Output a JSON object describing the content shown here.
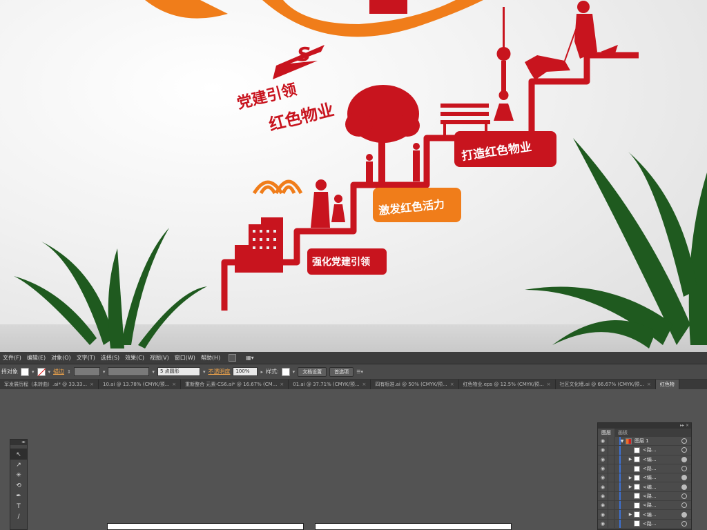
{
  "preview": {
    "logo_mark": "S",
    "slogan_line1": "党建引领",
    "slogan_line2": "红色物业",
    "step_labels": [
      "强化党建引领",
      "激发红色活力",
      "打造红色物业"
    ],
    "colors": {
      "red": "#c8141e",
      "orange": "#f07d1a",
      "wall": "#eeeeee"
    }
  },
  "menubar": {
    "items": [
      "文件(F)",
      "编辑(E)",
      "对象(O)",
      "文字(T)",
      "选择(S)",
      "效果(C)",
      "视图(V)",
      "窗口(W)",
      "帮助(H)"
    ]
  },
  "controlbar": {
    "selection_label": "择对象",
    "stroke_label": "描边",
    "brush_value": "5 点圆形",
    "opacity_label": "不透明度",
    "opacity_value": "100%",
    "style_label": "样式:",
    "doc_setup_button": "文档设置",
    "preferences_button": "首选项"
  },
  "doctabs": [
    "军发展历程（未转曲）.ai* @ 33.33...",
    "10.ai @ 13.78% (CMYK/预...",
    "重新整合 元素-CS6.ai* @ 16.67% (CM...",
    "01.ai @ 37.71% (CMYK/预...",
    "四有标准.ai @ 50% (CMYK/预...",
    "红色物业.eps @ 12.5% (CMYK/预...",
    "社区文化墙.ai @ 66.67% (CMYK/预...",
    "红色物"
  ],
  "tools": [
    "↖",
    "↗",
    "✳",
    "⟲",
    "✒",
    "T",
    "/"
  ],
  "layers_panel": {
    "tab_layers": "图层",
    "tab_artboards": "画板",
    "layer_name": "图层 1",
    "rows": [
      {
        "name": "<路...",
        "expand": false,
        "target_filled": false
      },
      {
        "name": "<编...",
        "expand": true,
        "target_filled": true
      },
      {
        "name": "<路...",
        "expand": false,
        "target_filled": false
      },
      {
        "name": "<编...",
        "expand": true,
        "target_filled": true
      },
      {
        "name": "<编...",
        "expand": true,
        "target_filled": true
      },
      {
        "name": "<路...",
        "expand": false,
        "target_filled": false
      },
      {
        "name": "<路...",
        "expand": false,
        "target_filled": false
      },
      {
        "name": "<编...",
        "expand": true,
        "target_filled": true
      },
      {
        "name": "<路...",
        "expand": false,
        "target_filled": false
      }
    ]
  }
}
